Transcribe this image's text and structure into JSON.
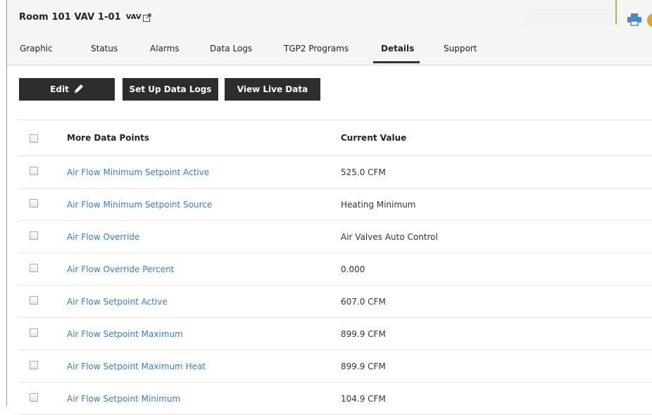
{
  "header": {
    "title": "Room 101 VAV 1-01",
    "device_type": "VAV",
    "icons": {
      "external": "external-link-icon",
      "print": "print-icon",
      "help": "help-icon"
    },
    "help_glyph": "?",
    "accent_color": "#8bc34a"
  },
  "tabs": [
    {
      "label": "Graphic"
    },
    {
      "label": "Status"
    },
    {
      "label": "Alarms"
    },
    {
      "label": "Data Logs"
    },
    {
      "label": "TGP2 Programs"
    },
    {
      "label": "Details",
      "active": true
    },
    {
      "label": "Support"
    }
  ],
  "toolbar": {
    "edit_label": "Edit",
    "setup_logs_label": "Set Up Data Logs",
    "live_data_label": "View Live Data"
  },
  "table": {
    "headers": {
      "points": "More Data Points",
      "value": "Current Value"
    },
    "rows": [
      {
        "name": "Air Flow Minimum Setpoint Active",
        "value": "525.0 CFM"
      },
      {
        "name": "Air Flow Minimum Setpoint Source",
        "value": "Heating Minimum"
      },
      {
        "name": "Air Flow Override",
        "value": "Air Valves Auto Control"
      },
      {
        "name": "Air Flow Override Percent",
        "value": "0.000"
      },
      {
        "name": "Air Flow Setpoint Active",
        "value": "607.0 CFM"
      },
      {
        "name": "Air Flow Setpoint Maximum",
        "value": "899.9 CFM"
      },
      {
        "name": "Air Flow Setpoint Maximum Heat",
        "value": "899.9 CFM"
      },
      {
        "name": "Air Flow Setpoint Minimum",
        "value": "104.9 CFM"
      }
    ],
    "link_color": "#3f7bbf"
  }
}
